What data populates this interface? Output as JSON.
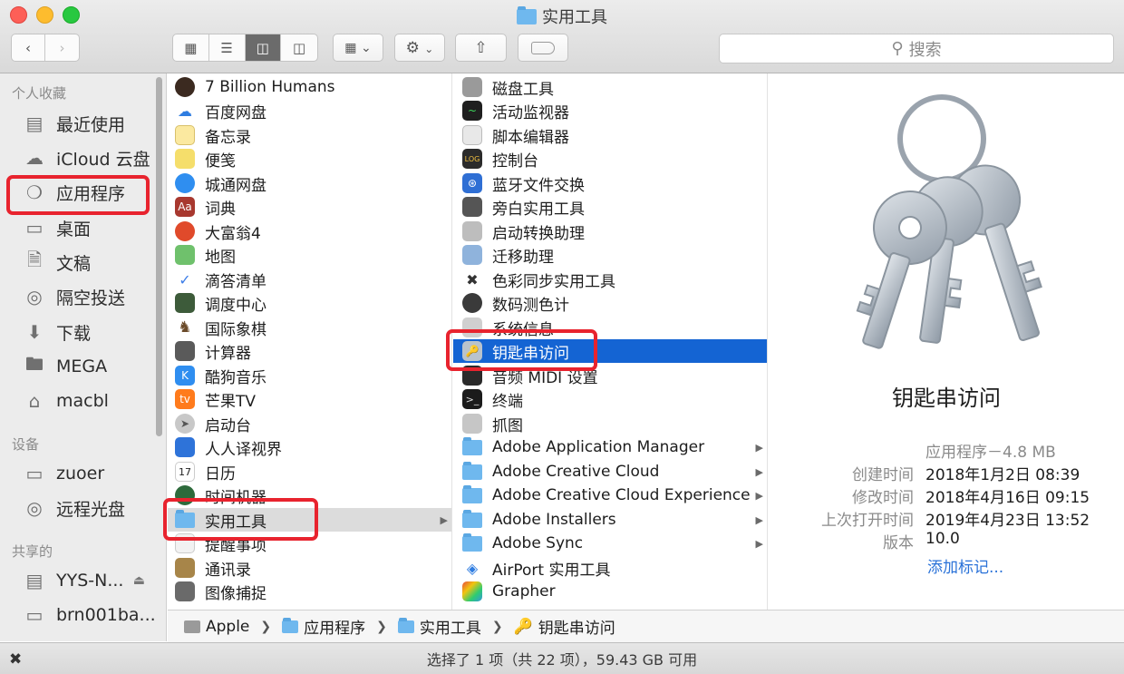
{
  "window": {
    "title": "实用工具"
  },
  "search": {
    "placeholder": "搜索"
  },
  "sidebar": {
    "favorites_heading": "个人收藏",
    "favorites": [
      {
        "label": "最近使用",
        "icon": "recents-icon"
      },
      {
        "label": "iCloud 云盘",
        "icon": "icloud-icon"
      },
      {
        "label": "应用程序",
        "icon": "applications-icon"
      },
      {
        "label": "桌面",
        "icon": "desktop-icon"
      },
      {
        "label": "文稿",
        "icon": "documents-icon"
      },
      {
        "label": "隔空投送",
        "icon": "airdrop-icon"
      },
      {
        "label": "下载",
        "icon": "downloads-icon"
      },
      {
        "label": "MEGA",
        "icon": "folder-icon"
      },
      {
        "label": "macbl",
        "icon": "home-icon"
      }
    ],
    "devices_heading": "设备",
    "devices": [
      {
        "label": "zuoer",
        "icon": "laptop-icon"
      },
      {
        "label": "远程光盘",
        "icon": "disc-icon"
      }
    ],
    "shared_heading": "共享的",
    "shared": [
      {
        "label": "YYS-N...",
        "icon": "server-icon"
      },
      {
        "label": "brn001ba...",
        "icon": "display-icon"
      }
    ]
  },
  "column1": {
    "items": [
      "7 Billion Humans",
      "百度网盘",
      "备忘录",
      "便笺",
      "城通网盘",
      "词典",
      "大富翁4",
      "地图",
      "滴答清单",
      "调度中心",
      "国际象棋",
      "计算器",
      "酷狗音乐",
      "芒果TV",
      "启动台",
      "人人译视界",
      "日历",
      "时间机器",
      "实用工具",
      "提醒事项",
      "通讯录",
      "图像捕捉"
    ],
    "selected": "实用工具"
  },
  "column2": {
    "items": [
      "磁盘工具",
      "活动监视器",
      "脚本编辑器",
      "控制台",
      "蓝牙文件交换",
      "旁白实用工具",
      "启动转换助理",
      "迁移助理",
      "色彩同步实用工具",
      "数码测色计",
      "系统信息",
      "钥匙串访问",
      "音频 MIDI 设置",
      "终端",
      "抓图",
      "Adobe Application Manager",
      "Adobe Creative Cloud",
      "Adobe Creative Cloud Experience",
      "Adobe Installers",
      "Adobe Sync",
      "AirPort 实用工具",
      "Grapher"
    ],
    "selected": "钥匙串访问"
  },
  "preview": {
    "name": "钥匙串访问",
    "kind": "应用程序－4.8 MB",
    "created_label": "创建时间",
    "created": "2018年1月2日 08:39",
    "modified_label": "修改时间",
    "modified": "2018年4月16日 09:15",
    "opened_label": "上次打开时间",
    "opened": "2019年4月23日 13:52",
    "version_label": "版本",
    "version": "10.0",
    "add_tags": "添加标记..."
  },
  "pathbar": {
    "items": [
      "Apple",
      "应用程序",
      "实用工具",
      "钥匙串访问"
    ]
  },
  "status": {
    "text": "选择了 1 项（共 22 项），59.43 GB 可用"
  },
  "colors": {
    "selection": "#1464d3",
    "highlight": "#e8232e",
    "link": "#2a72d8"
  }
}
